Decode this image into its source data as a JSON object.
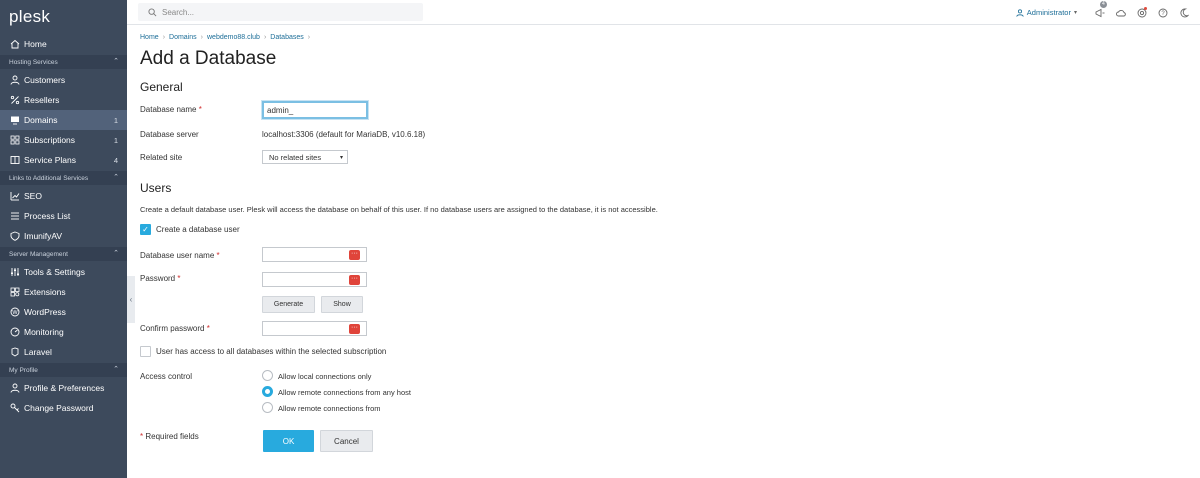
{
  "app": {
    "logo": "plesk"
  },
  "sidebar": {
    "items": [
      {
        "type": "item",
        "label": "Home",
        "icon": "home-icon",
        "name": "sidebar-item-home"
      },
      {
        "type": "section",
        "label": "Hosting Services",
        "name": "section-hosting-services"
      },
      {
        "type": "item",
        "label": "Customers",
        "icon": "customers-icon",
        "name": "sidebar-item-customers"
      },
      {
        "type": "item",
        "label": "Resellers",
        "icon": "percent-icon",
        "name": "sidebar-item-resellers"
      },
      {
        "type": "item",
        "label": "Domains",
        "icon": "monitor-icon",
        "count": "1",
        "active": true,
        "name": "sidebar-item-domains"
      },
      {
        "type": "item",
        "label": "Subscriptions",
        "icon": "grid-icon",
        "count": "1",
        "name": "sidebar-item-subscriptions"
      },
      {
        "type": "item",
        "label": "Service Plans",
        "icon": "plans-icon",
        "count": "4",
        "name": "sidebar-item-service-plans"
      },
      {
        "type": "section",
        "label": "Links to Additional Services",
        "name": "section-links"
      },
      {
        "type": "item",
        "label": "SEO",
        "icon": "chart-icon",
        "name": "sidebar-item-seo"
      },
      {
        "type": "item",
        "label": "Process List",
        "icon": "list-icon",
        "name": "sidebar-item-process-list"
      },
      {
        "type": "item",
        "label": "ImunifyAV",
        "icon": "shield-icon",
        "name": "sidebar-item-imunifyav"
      },
      {
        "type": "section",
        "label": "Server Management",
        "name": "section-server-management"
      },
      {
        "type": "item",
        "label": "Tools & Settings",
        "icon": "tools-icon",
        "name": "sidebar-item-tools-settings"
      },
      {
        "type": "item",
        "label": "Extensions",
        "icon": "extensions-icon",
        "name": "sidebar-item-extensions"
      },
      {
        "type": "item",
        "label": "WordPress",
        "icon": "wordpress-icon",
        "name": "sidebar-item-wordpress"
      },
      {
        "type": "item",
        "label": "Monitoring",
        "icon": "monitoring-icon",
        "name": "sidebar-item-monitoring"
      },
      {
        "type": "item",
        "label": "Laravel",
        "icon": "laravel-icon",
        "name": "sidebar-item-laravel"
      },
      {
        "type": "section",
        "label": "My Profile",
        "name": "section-my-profile"
      },
      {
        "type": "item",
        "label": "Profile & Preferences",
        "icon": "profile-icon",
        "name": "sidebar-item-profile"
      },
      {
        "type": "item",
        "label": "Change Password",
        "icon": "key-icon",
        "name": "sidebar-item-change-password"
      }
    ]
  },
  "header": {
    "search_placeholder": "Search...",
    "user": "Administrator",
    "notifications_count": "4"
  },
  "breadcrumb": [
    "Home",
    "Domains",
    "webdemo88.club",
    "Databases"
  ],
  "page_title": "Add a Database",
  "general": {
    "title": "General",
    "db_name_label": "Database name",
    "db_name_value": "admin_",
    "db_server_label": "Database server",
    "db_server_value": "localhost:3306 (default for MariaDB, v10.6.18)",
    "related_site_label": "Related site",
    "related_site_value": "No related sites"
  },
  "users": {
    "title": "Users",
    "description": "Create a default database user. Plesk will access the database on behalf of this user. If no database users are assigned to the database, it is not accessible.",
    "create_user_label": "Create a database user",
    "create_user_checked": true,
    "db_user_label": "Database user name",
    "password_label": "Password",
    "generate_label": "Generate",
    "show_label": "Show",
    "confirm_label": "Confirm password",
    "access_all_label": "User has access to all databases within the selected subscription",
    "access_control_label": "Access control",
    "access_options": [
      {
        "label": "Allow local connections only",
        "checked": false
      },
      {
        "label": "Allow remote connections from any host",
        "checked": true
      },
      {
        "label": "Allow remote connections from",
        "checked": false
      }
    ]
  },
  "footer": {
    "required_note": "Required fields",
    "ok_label": "OK",
    "cancel_label": "Cancel"
  },
  "colors": {
    "sidebar": "#3d4a5c",
    "accent": "#28aade",
    "link": "#1d6e98",
    "required": "#d02d2d"
  }
}
